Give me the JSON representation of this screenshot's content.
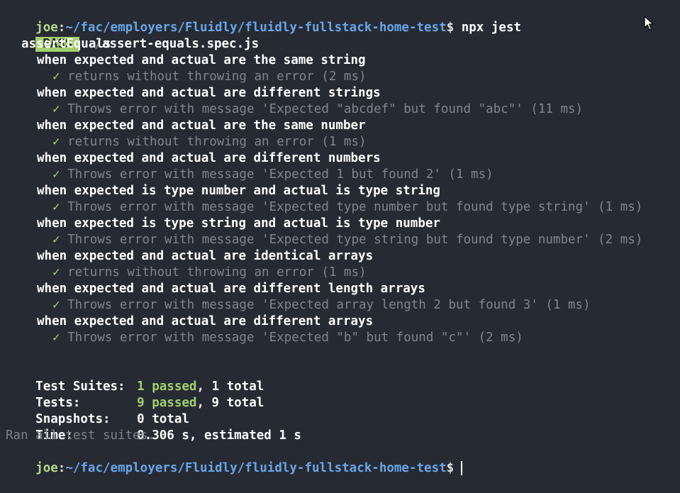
{
  "prompt": {
    "user": "joe",
    "separator": ":",
    "path": "~/fac/employers/Fluidly/fluidly-fullstack-home-test",
    "dollar": "$",
    "command": " npx jest"
  },
  "result": {
    "badge": "PASS",
    "file_dir": "./",
    "file_name": "assert-equals.spec.js"
  },
  "suite_name": "assertEquals",
  "groups": [
    {
      "describe": "when expected and actual are the same string",
      "check": "✓",
      "test": "returns without throwing an error (2 ms)"
    },
    {
      "describe": "when expected and actual are different strings",
      "check": "✓",
      "test": "Throws error with message 'Expected \"abcdef\" but found \"abc\"' (11 ms)"
    },
    {
      "describe": "when expected and actual are the same number",
      "check": "✓",
      "test": "returns without throwing an error (1 ms)"
    },
    {
      "describe": "when expected and actual are different numbers",
      "check": "✓",
      "test": "Throws error with message 'Expected 1 but found 2' (1 ms)"
    },
    {
      "describe": "when expected is type number and actual is type string",
      "check": "✓",
      "test": "Throws error with message 'Expected type number but found type string' (1 ms)"
    },
    {
      "describe": "when expected is type string and actual is type number",
      "check": "✓",
      "test": "Throws error with message 'Expected type string but found type number' (2 ms)"
    },
    {
      "describe": "when expected and actual are identical arrays",
      "check": "✓",
      "test": "returns without throwing an error (1 ms)"
    },
    {
      "describe": "when expected and actual are different length arrays",
      "check": "✓",
      "test": "Throws error with message 'Expected array length 2 but found 3' (1 ms)"
    },
    {
      "describe": "when expected and actual are different arrays",
      "check": "✓",
      "test": "Throws error with message 'Expected \"b\" but found \"c\"' (2 ms)"
    }
  ],
  "summary": {
    "suites_label": "Test Suites:",
    "suites_passed": "1 passed",
    "suites_rest": ", 1 total",
    "tests_label": "Tests:",
    "tests_passed": "9 passed",
    "tests_rest": ", 9 total",
    "snapshots_label": "Snapshots:",
    "snapshots_value": "0 total",
    "time_label": "Time:",
    "time_value": "0.306 s, estimated 1 s",
    "ran_all": "Ran all test suites."
  },
  "final_prompt": {
    "user": "joe",
    "separator": ":",
    "path": "~/fac/employers/Fluidly/fluidly-fullstack-home-test",
    "dollar": "$"
  },
  "icons": {
    "check": "check-icon",
    "pointer": "mouse-pointer-icon"
  },
  "colors": {
    "background": "#262b33",
    "pass_green": "#a3d06d",
    "path_blue": "#6aa6e8",
    "dim_gray": "#80858e"
  }
}
